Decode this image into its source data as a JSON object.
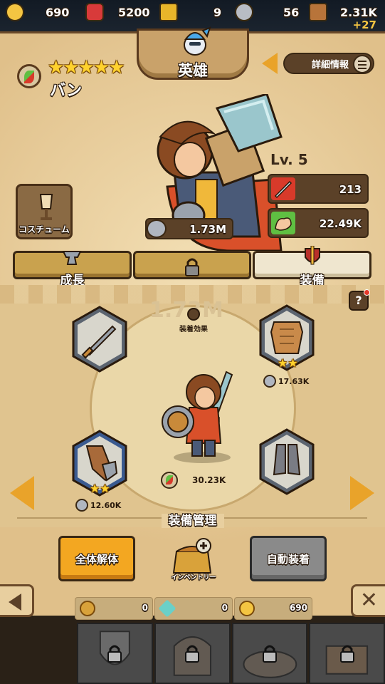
{
  "resources": {
    "gold": "690",
    "gems": "5200",
    "keys": "9",
    "tickets": "56",
    "wood": "2.31K",
    "wood_gain": "+27"
  },
  "header": {
    "title": "英雄",
    "detail_label": "詳細情報"
  },
  "hero": {
    "stars": "★★★★★",
    "name": "バン",
    "level": "Lv. 5",
    "attack": "213",
    "hp": "22.49K",
    "power": "1.73M",
    "costume_label": "コスチューム"
  },
  "tabs": [
    {
      "label": "成長",
      "locked": false,
      "active": false
    },
    {
      "label": "",
      "locked": true,
      "active": false
    },
    {
      "label": "装備",
      "locked": false,
      "active": true
    }
  ],
  "equipment": {
    "watermark": "1.73M",
    "set_effect_label": "装着効果",
    "help_label": "?",
    "slots": [
      {
        "slot": "weapon",
        "stars": "",
        "power": ""
      },
      {
        "slot": "armor",
        "stars": "★★",
        "power": "17.63K"
      },
      {
        "slot": "gloves",
        "stars": "★★",
        "power": "12.60K"
      },
      {
        "slot": "boots",
        "stars": "",
        "power": ""
      }
    ],
    "center_power": "30.23K"
  },
  "management": {
    "title": "装備管理",
    "dismantle_label": "全体解体",
    "inventory_label": "インベントリー",
    "auto_equip_label": "自動装着"
  },
  "bottom_resources": [
    {
      "icon": "scroll-icon",
      "value": "0"
    },
    {
      "icon": "crystal-icon",
      "value": "0"
    },
    {
      "icon": "gold-coin-icon",
      "value": "690"
    }
  ],
  "close_label": "✕",
  "colors": {
    "accent_orange": "#f3a721",
    "panel": "#e8cf9f",
    "dark_brown": "#5b4128",
    "star": "#ffd22e"
  }
}
